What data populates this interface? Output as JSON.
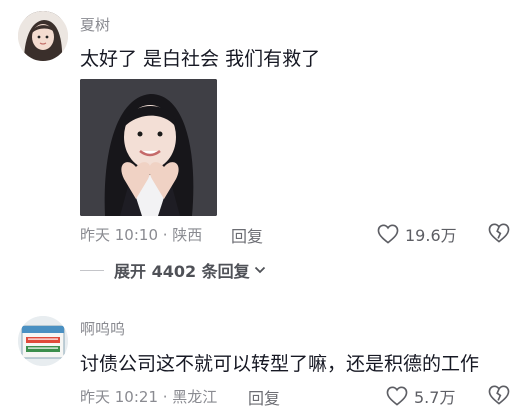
{
  "comments": [
    {
      "username": "夏树",
      "text": "太好了 是白社会 我们有救了",
      "meta": "昨天 10:10 · 陕西",
      "reply_label": "回复",
      "likes": "19.6万",
      "avatar_icon": "user-avatar-girl",
      "image_icon": "photo-woman-heart-hands"
    },
    {
      "username": "啊呜呜",
      "text": "讨债公司这不就可以转型了嘛，还是积德的工作",
      "meta": "昨天 10:21 · 黑龙江",
      "reply_label": "回复",
      "likes": "5.7万",
      "avatar_icon": "user-avatar-sticker"
    }
  ],
  "expand_replies": "展开 4402 条回复",
  "colors": {
    "text": "#161823",
    "secondary": "#8a8b91"
  }
}
